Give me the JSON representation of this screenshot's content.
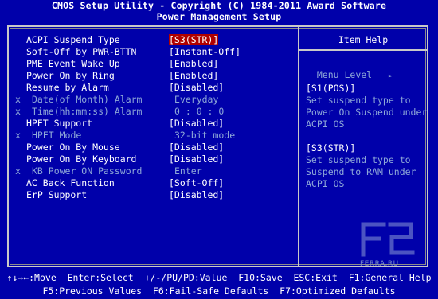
{
  "header": {
    "line1": "CMOS Setup Utility - Copyright (C) 1984-2011 Award Software",
    "line2": "Power Management Setup"
  },
  "settings": [
    {
      "label": "ACPI Suspend Type",
      "value": "[S3(STR)]",
      "state": "selected"
    },
    {
      "label": "Soft-Off by PWR-BTTN",
      "value": "[Instant-Off]",
      "state": "normal"
    },
    {
      "label": "PME Event Wake Up",
      "value": "[Enabled]",
      "state": "normal"
    },
    {
      "label": "Power On by Ring",
      "value": "[Enabled]",
      "state": "normal"
    },
    {
      "label": "Resume by Alarm",
      "value": "[Disabled]",
      "state": "normal"
    },
    {
      "mark": "x",
      "label": "Date(of Month) Alarm",
      "value": "Everyday",
      "state": "disabled"
    },
    {
      "mark": "x",
      "label": "Time(hh:mm:ss) Alarm",
      "value": "0 : 0 : 0",
      "state": "disabled"
    },
    {
      "label": "HPET Support",
      "value": "[Disabled]",
      "state": "normal"
    },
    {
      "mark": "x",
      "label": "HPET Mode",
      "value": "32-bit mode",
      "state": "disabled"
    },
    {
      "label": "Power On By Mouse",
      "value": "[Disabled]",
      "state": "normal"
    },
    {
      "label": "Power On By Keyboard",
      "value": "[Disabled]",
      "state": "normal"
    },
    {
      "mark": "x",
      "label": "KB Power ON Password",
      "value": "Enter",
      "state": "disabled"
    },
    {
      "label": "AC Back Function",
      "value": "[Soft-Off]",
      "state": "normal"
    },
    {
      "label": "ErP Support",
      "value": "[Disabled]",
      "state": "normal"
    }
  ],
  "help": {
    "title": "Item Help",
    "menu_level": "Menu Level",
    "menu_level_arrow": "►",
    "lines": [
      "[S1(POS)]",
      "Set suspend type to",
      "Power On Suspend under",
      "ACPI OS",
      "",
      "[S3(STR)]",
      "Set suspend type to",
      "Suspend to RAM under",
      "ACPI OS"
    ]
  },
  "footer": {
    "line1": "↑↓→←:Move  Enter:Select  +/-/PU/PD:Value  F10:Save  ESC:Exit  F1:General Help",
    "line2": "F5:Previous Values  F6:Fail-Safe Defaults  F7:Optimized Defaults"
  },
  "watermark": {
    "text": "FERRA.RU"
  },
  "colors": {
    "background": "#0000aa",
    "text": "#ffffff",
    "disabled_text": "#8ea8d8",
    "highlight": "#b00000",
    "frame": "#c8c8c8"
  }
}
